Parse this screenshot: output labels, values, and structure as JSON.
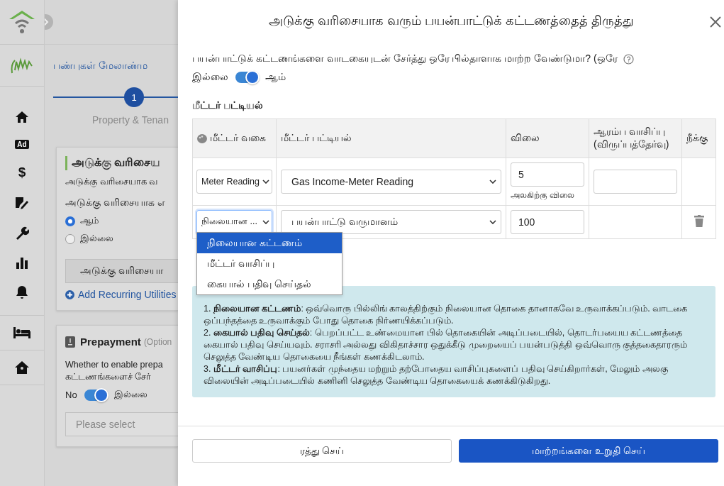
{
  "sidebar": {
    "items": [
      {
        "kind": "home"
      },
      {
        "kind": "badge",
        "label": "Ad"
      },
      {
        "kind": "glyph",
        "label": "$"
      },
      {
        "kind": "edit"
      },
      {
        "kind": "wrench"
      },
      {
        "kind": "chart"
      },
      {
        "kind": "bell"
      }
    ],
    "bottom_items": [
      {
        "kind": "bed"
      },
      {
        "kind": "house"
      }
    ]
  },
  "background": {
    "tab_title": "பண்புகள் மேலாண்ம",
    "step": {
      "number": "1",
      "label": "Property & Tenan"
    },
    "card": {
      "title": "அடுக்கு வரிசைய",
      "text": "அடுக்கு வரிசையாக வ",
      "question": "அடுக்கு வரிசையாக எ",
      "radios": [
        {
          "label": "ஆம்",
          "selected": true
        },
        {
          "label": "இல்லை",
          "selected": false
        }
      ],
      "button": "அடுக்கு வரிசையா",
      "link": "Add Recurring Utilities"
    },
    "prepayment": {
      "title": "Prepayment",
      "optional": "(Option",
      "lines": [
        "Whether to enable prepa",
        "கட்டணங்களைச் சேர்"
      ],
      "toggle": {
        "off_label": "No",
        "on_label": "இல்லை",
        "on": true
      },
      "select": {
        "placeholder": "Please select"
      }
    }
  },
  "modal": {
    "title": "அடுக்கு வரிசையாக வரும் பயன்பாட்டுக் கட்டணத்தைத் திருத்து",
    "question": "பயன்பாட்டுக் கட்டணங்களை வாடகையுடன் சேர்த்து ஒரே பில்தாளாக மாற்ற வேண்டுமா? (ஒரே",
    "toggle": {
      "off_label": "இல்லை",
      "on_label": "ஆம்",
      "on": true
    },
    "section_title": "மீட்டர் பட்டியல்",
    "table": {
      "columns": [
        "மீட்டர் வகை",
        "மீட்டர் பட்டியல்",
        "விலை",
        "ஆரம்ப வாசிப்பு (விருப்பத்தேர்வு)",
        "நீக்கு"
      ],
      "rows": [
        {
          "type": "Meter Reading",
          "type_focused": false,
          "list": "Gas Income-Meter Reading",
          "price": "5",
          "price_hint": "அலகிற்கு விலை",
          "start_reading_field": true,
          "removable": false
        },
        {
          "type": "நிலையான ...",
          "type_focused": true,
          "list": "பயன்பாட்டு வருமானம்",
          "price": "100",
          "start_reading_field": false,
          "removable": true
        }
      ]
    },
    "dropdown": {
      "options": [
        {
          "label": "நிலையான கட்டணம்",
          "selected": true
        },
        {
          "label": "மீட்டர் வாசிப்பு",
          "selected": false
        },
        {
          "label": "கையால் பதிவு செய்தல்",
          "selected": false
        }
      ]
    },
    "info": [
      "1. **நிலையான கட்டணம்**: ஒவ்வொரு பில்லிங் காலத்திற்கும் நிலையான தொகை தானாகவே உருவாக்கப்படும். வாடகை ஒப்பந்தத்தை உருவாக்கும் போது தொகை நிர்ணயிக்கப்படும்.",
      "2. **கையால் பதிவு செய்தல்**: பெறப்பட்ட உண்மையான பில் தொகையின் அடிப்படையில், தொடர்பயைய கட்டணத்தை கையால் பதிவு செய்யவும். சராசரி அல்லது விகிதாச்சார ஒதுக்கீடு முறையைப் பயன்படுத்தி ஒவ்வொரு குத்தகைதாரரும் செலுத்த வேண்டிய தொகையை நீங்கள் கணக்கிடலாம்.",
      "3. **மீட்டர் வாசிப்பு**: பயனர்கள் முந்தைய மற்றும் தற்போதைய வாசிப்புகளைப் பதிவு செய்கிறார்கள், மேலும் அலகு விலையின் அடிப்படையில் கணினி செலுத்த வேண்டிய தொகையைக் கணக்கிடுகிறது."
    ],
    "buttons": {
      "cancel": "ரத்து செய்",
      "confirm": "மாற்றங்களை உறுதி செய்"
    }
  }
}
